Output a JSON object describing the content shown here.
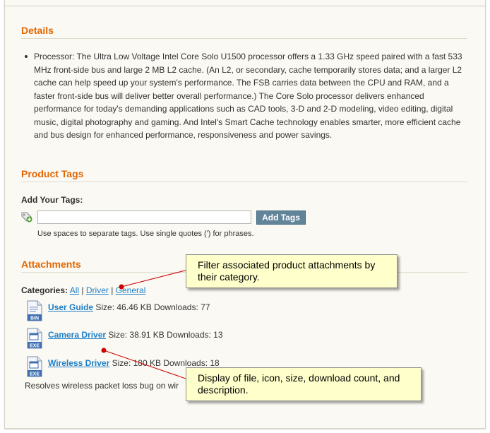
{
  "details": {
    "title": "Details",
    "bullet": "Processor: The Ultra Low Voltage Intel Core Solo U1500 processor offers a 1.33 GHz speed paired with a fast 533 MHz front-side bus and large 2 MB L2 cache. (An L2, or secondary, cache temporarily stores data; and a larger L2 cache can help speed up your system's performance. The FSB carries data between the CPU and RAM, and a faster front-side bus will deliver better overall performance.) The Core Solo processor delivers enhanced performance for today's demanding applications such as CAD tools, 3-D and 2-D modeling, video editing, digital music, digital photography and gaming. And Intel's Smart Cache technology enables smarter, more efficient cache and bus design for enhanced performance, responsiveness and power savings."
  },
  "tags": {
    "title": "Product Tags",
    "add_label": "Add Your Tags:",
    "input_value": "",
    "button": "Add Tags",
    "hint": "Use spaces to separate tags. Use single quotes (') for phrases."
  },
  "attachments": {
    "title": "Attachments",
    "categories_label": "Categories:",
    "categories": [
      "All",
      "Driver",
      "General"
    ],
    "files": [
      {
        "name": "User Guide",
        "info": "Size: 46.46 KB Downloads: 77",
        "icon": "bin-file-icon",
        "badge": "BIN"
      },
      {
        "name": "Camera Driver",
        "info": "Size: 38.91 KB Downloads: 13",
        "icon": "exe-file-icon",
        "badge": "EXE"
      },
      {
        "name": "Wireless Driver",
        "info": "Size: 180 KB Downloads: 18",
        "icon": "exe-file-icon",
        "badge": "EXE"
      }
    ],
    "description": "Resolves wireless packet loss bug on wir"
  },
  "callouts": {
    "filter": "Filter associated product attachments by their category.",
    "display": "Display of file, icon, size, download count, and description."
  },
  "colors": {
    "section_title": "#e26703",
    "link": "#1e7ec8",
    "button": "#618499",
    "callout_bg": "#ffffcc",
    "arrow": "#cc0000"
  }
}
